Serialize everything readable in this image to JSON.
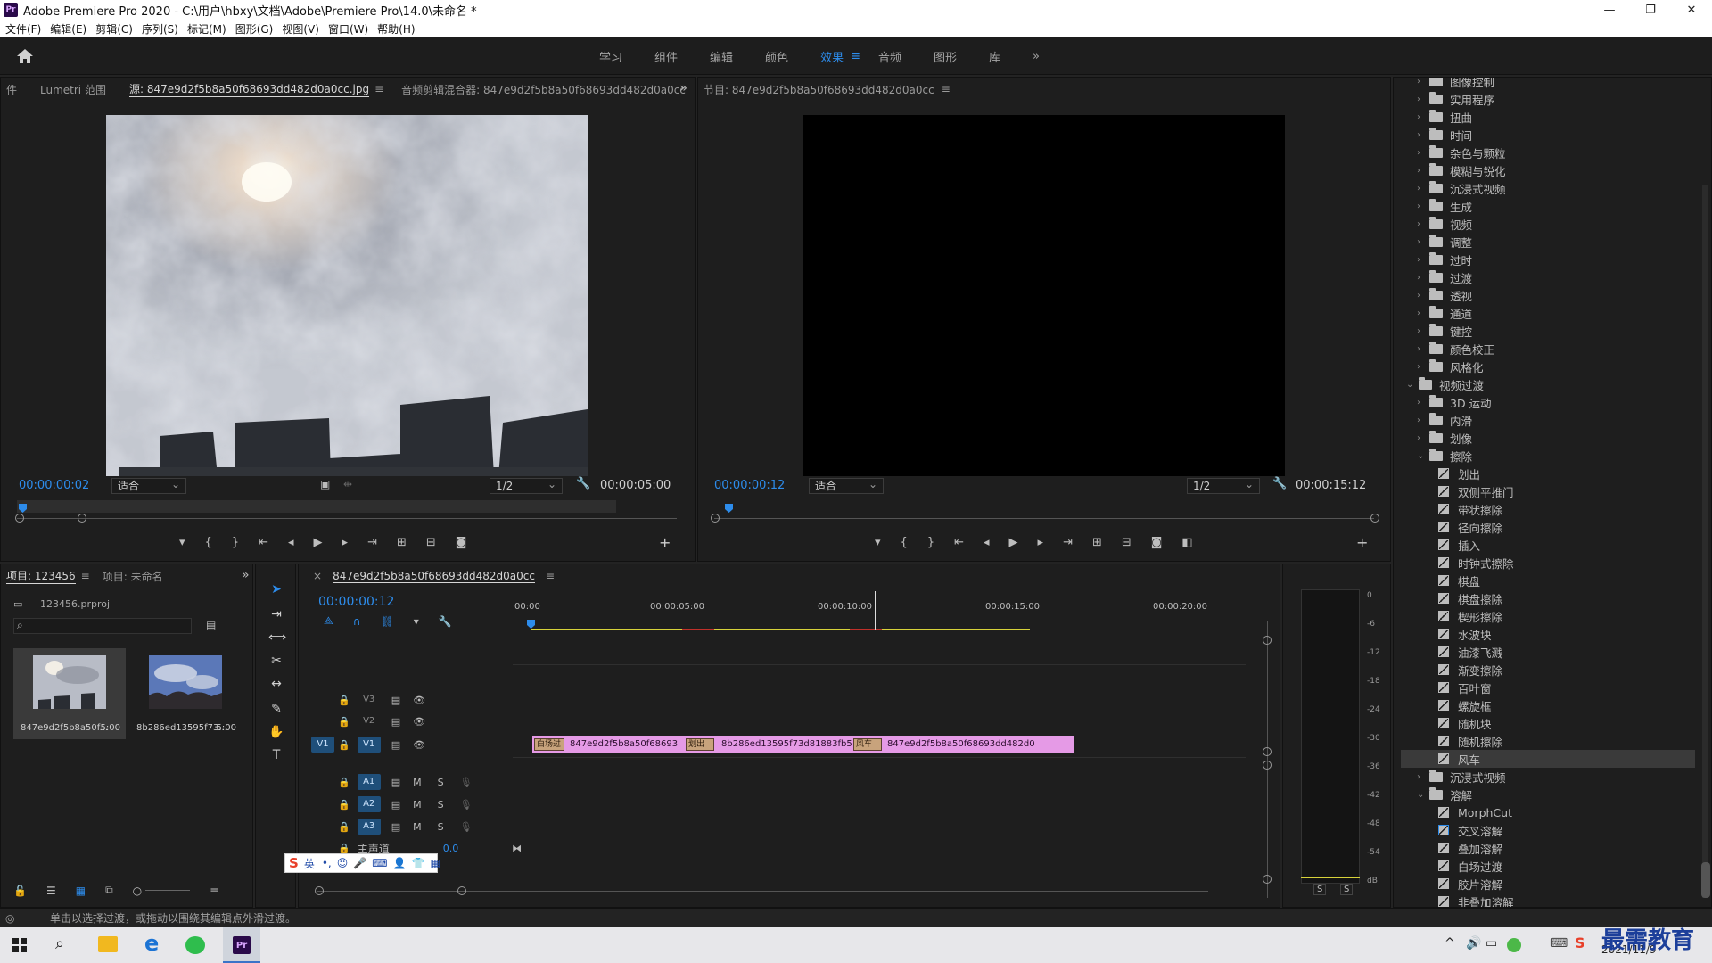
{
  "window": {
    "title": "Adobe Premiere Pro 2020 - C:\\用户\\hbxy\\文档\\Adobe\\Premiere Pro\\14.0\\未命名 *",
    "controls": [
      "—",
      "❐",
      "✕"
    ]
  },
  "menu": [
    "文件(F)",
    "编辑(E)",
    "剪辑(C)",
    "序列(S)",
    "标记(M)",
    "图形(G)",
    "视图(V)",
    "窗口(W)",
    "帮助(H)"
  ],
  "workspaces": {
    "tabs": [
      "学习",
      "组件",
      "编辑",
      "颜色",
      "效果",
      "音频",
      "图形",
      "库"
    ],
    "active": "效果",
    "more": "»"
  },
  "source_panel": {
    "tabs": [
      "件",
      "Lumetri 范围",
      "源: 847e9d2f5b8a50f68693dd482d0a0cc.jpg",
      "音频剪辑混合器: 847e9d2f5b8a50f68693dd482d0a0cc"
    ],
    "timecode": "00:00:00:02",
    "fit": "适合",
    "resolution": "1/2",
    "duration": "00:00:05:00"
  },
  "program_panel": {
    "title": "节目: 847e9d2f5b8a50f68693dd482d0a0cc",
    "timecode": "00:00:00:12",
    "fit": "适合",
    "resolution": "1/2",
    "duration": "00:00:15:12"
  },
  "project_panel": {
    "tabs": [
      "项目: 123456",
      "项目: 未命名"
    ],
    "file": "123456.prproj",
    "search_placeholder": "",
    "items": [
      {
        "name": "847e9d2f5b8a50f...",
        "duration": "5:00"
      },
      {
        "name": "8b286ed13595f73...",
        "duration": "5:00"
      }
    ]
  },
  "timeline": {
    "tab": "847e9d2f5b8a50f68693dd482d0a0cc",
    "timecode": "00:00:00:12",
    "ruler": [
      "00:00",
      "00:00:05:00",
      "00:00:10:00",
      "00:00:15:00",
      "00:00:20:00"
    ],
    "tracks": {
      "video": [
        "V3",
        "V2",
        "V1"
      ],
      "audio": [
        "A1",
        "A2",
        "A3"
      ],
      "master_label": "主声道",
      "master_value": "0.0",
      "source_patch": "V1",
      "mute": "M",
      "solo": "S"
    },
    "clips": [
      {
        "label": "847e9d2f5b8a50f68693"
      },
      {
        "label": "8b286ed13595f73d81883fb5"
      },
      {
        "label": "847e9d2f5b8a50f68693dd482d0"
      }
    ],
    "transitions": [
      "白场过",
      "划出",
      "风车"
    ]
  },
  "effects": {
    "items": [
      {
        "label": "图像控制",
        "type": "folder",
        "level": 1
      },
      {
        "label": "实用程序",
        "type": "folder",
        "level": 1
      },
      {
        "label": "扭曲",
        "type": "folder",
        "level": 1
      },
      {
        "label": "时间",
        "type": "folder",
        "level": 1
      },
      {
        "label": "杂色与颗粒",
        "type": "folder",
        "level": 1
      },
      {
        "label": "模糊与锐化",
        "type": "folder",
        "level": 1
      },
      {
        "label": "沉浸式视频",
        "type": "folder",
        "level": 1
      },
      {
        "label": "生成",
        "type": "folder",
        "level": 1
      },
      {
        "label": "视频",
        "type": "folder",
        "level": 1
      },
      {
        "label": "调整",
        "type": "folder",
        "level": 1
      },
      {
        "label": "过时",
        "type": "folder",
        "level": 1
      },
      {
        "label": "过渡",
        "type": "folder",
        "level": 1
      },
      {
        "label": "透视",
        "type": "folder",
        "level": 1
      },
      {
        "label": "通道",
        "type": "folder",
        "level": 1
      },
      {
        "label": "键控",
        "type": "folder",
        "level": 1
      },
      {
        "label": "颜色校正",
        "type": "folder",
        "level": 1
      },
      {
        "label": "风格化",
        "type": "folder",
        "level": 1
      },
      {
        "label": "视频过渡",
        "type": "folder-open",
        "level": 0
      },
      {
        "label": "3D 运动",
        "type": "folder",
        "level": 1
      },
      {
        "label": "内滑",
        "type": "folder",
        "level": 1
      },
      {
        "label": "划像",
        "type": "folder",
        "level": 1
      },
      {
        "label": "擦除",
        "type": "folder-open",
        "level": 1
      },
      {
        "label": "划出",
        "type": "fx",
        "level": 2
      },
      {
        "label": "双侧平推门",
        "type": "fx",
        "level": 2
      },
      {
        "label": "带状擦除",
        "type": "fx",
        "level": 2
      },
      {
        "label": "径向擦除",
        "type": "fx",
        "level": 2
      },
      {
        "label": "插入",
        "type": "fx",
        "level": 2
      },
      {
        "label": "时钟式擦除",
        "type": "fx",
        "level": 2
      },
      {
        "label": "棋盘",
        "type": "fx",
        "level": 2
      },
      {
        "label": "棋盘擦除",
        "type": "fx",
        "level": 2
      },
      {
        "label": "楔形擦除",
        "type": "fx",
        "level": 2
      },
      {
        "label": "水波块",
        "type": "fx",
        "level": 2
      },
      {
        "label": "油漆飞溅",
        "type": "fx",
        "level": 2
      },
      {
        "label": "渐变擦除",
        "type": "fx",
        "level": 2
      },
      {
        "label": "百叶窗",
        "type": "fx",
        "level": 2
      },
      {
        "label": "螺旋框",
        "type": "fx",
        "level": 2
      },
      {
        "label": "随机块",
        "type": "fx",
        "level": 2
      },
      {
        "label": "随机擦除",
        "type": "fx",
        "level": 2
      },
      {
        "label": "风车",
        "type": "fx",
        "level": 2,
        "selected": true
      },
      {
        "label": "沉浸式视频",
        "type": "folder",
        "level": 1
      },
      {
        "label": "溶解",
        "type": "folder-open",
        "level": 1
      },
      {
        "label": "MorphCut",
        "type": "fx",
        "level": 2
      },
      {
        "label": "交叉溶解",
        "type": "fx",
        "level": 2
      },
      {
        "label": "叠加溶解",
        "type": "fx",
        "level": 2
      },
      {
        "label": "白场过渡",
        "type": "fx",
        "level": 2
      },
      {
        "label": "胶片溶解",
        "type": "fx",
        "level": 2
      },
      {
        "label": "非叠加溶解",
        "type": "fx",
        "level": 2
      }
    ]
  },
  "meter": {
    "scale": [
      "0",
      "-6",
      "-12",
      "-18",
      "-24",
      "-30",
      "-36",
      "-42",
      "-48",
      "-54",
      "dB"
    ],
    "solo": [
      "S",
      "S"
    ]
  },
  "status_bar": "单击以选择过渡，或拖动以围绕其编辑点外滑过渡。",
  "ime": {
    "mode": "英"
  },
  "taskbar": {
    "date": "2021/11/9",
    "watermark": "最需教育"
  },
  "colors": {
    "accent": "#2d8ceb",
    "clip": "#e59ae6",
    "work_area": "#d7d23a",
    "render_red": "#c0302a"
  }
}
